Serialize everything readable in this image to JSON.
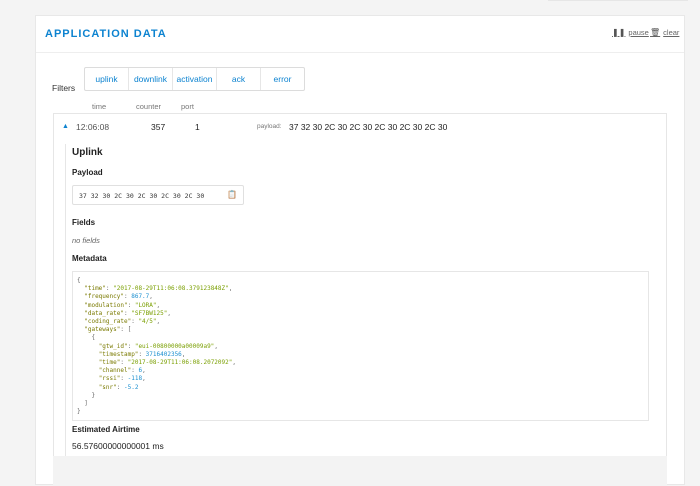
{
  "panel": {
    "title": "APPLICATION DATA",
    "pause_label": "pause",
    "clear_label": "clear"
  },
  "filters": {
    "label": "Filters",
    "items": [
      "uplink",
      "downlink",
      "activation",
      "ack",
      "error"
    ]
  },
  "columns": {
    "time": "time",
    "counter": "counter",
    "port": "port"
  },
  "message": {
    "time": "12:06:08",
    "counter": "357",
    "port": "1",
    "payload_label": "payload:",
    "payload": "37 32 30 2C 30 2C 30 2C 30 2C 30 2C 30"
  },
  "detail": {
    "title": "Uplink",
    "payload_title": "Payload",
    "payload_value": "37 32 30 2C 30 2C 30 2C 30 2C 30",
    "fields_title": "Fields",
    "fields_value": "no fields",
    "metadata_title": "Metadata",
    "airtime_title": "Estimated Airtime",
    "airtime_value": "56.57600000000001 ms"
  },
  "metadata": {
    "time": "\"2017-08-29T11:06:08.379123848Z\"",
    "frequency": "867.7",
    "modulation": "\"LORA\"",
    "data_rate": "\"SF7BW125\"",
    "coding_rate": "\"4/5\"",
    "gtw_id": "\"eui-00800000a00009a9\"",
    "timestamp": "3716402356",
    "gw_time": "\"2017-08-29T11:06:08.2072092\"",
    "channel": "6",
    "rssi": "-118",
    "snr": "-5.2"
  }
}
